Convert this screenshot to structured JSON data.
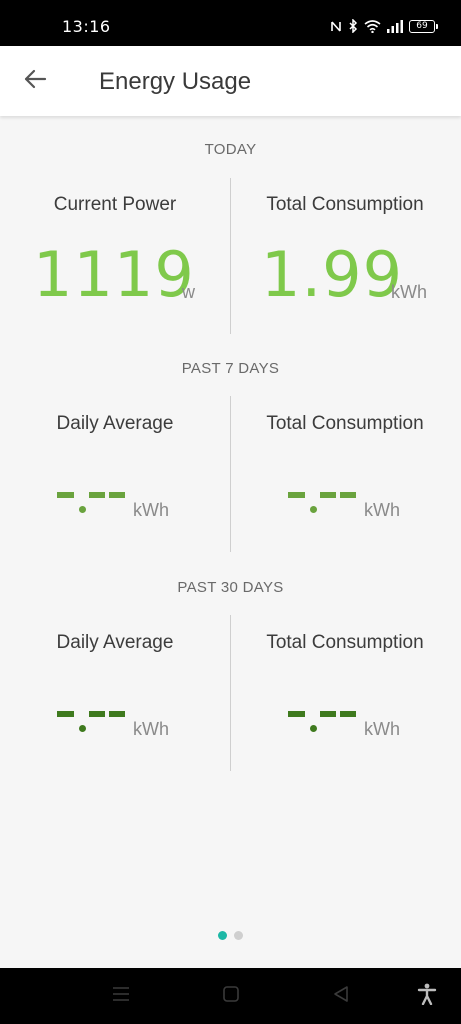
{
  "status_bar": {
    "time": "13:16",
    "battery": "69",
    "icons": [
      "nfc-icon",
      "bluetooth-icon",
      "wifi-icon",
      "signal-icon",
      "battery-icon"
    ]
  },
  "header": {
    "title": "Energy Usage",
    "back_icon": "arrow-left-icon"
  },
  "sections": [
    {
      "title": "TODAY",
      "left": {
        "label": "Current Power",
        "value": "1119",
        "unit": "w"
      },
      "right": {
        "label": "Total Consumption",
        "value": "1.99",
        "unit": "kWh"
      }
    },
    {
      "title": "PAST 7 DAYS",
      "left": {
        "label": "Daily Average",
        "value": "-.--",
        "unit": "kWh"
      },
      "right": {
        "label": "Total Consumption",
        "value": "-.--",
        "unit": "kWh"
      }
    },
    {
      "title": "PAST 30 DAYS",
      "left": {
        "label": "Daily Average",
        "value": "-.--",
        "unit": "kWh"
      },
      "right": {
        "label": "Total Consumption",
        "value": "-.--",
        "unit": "kWh"
      }
    }
  ],
  "pager": {
    "pages": 2,
    "active_index": 0
  },
  "colors": {
    "value_green": "#7fc94b",
    "past7_dash_green": "#6aa33e",
    "past30_dash_green": "#3f7a1e",
    "pager_active": "#1db8a6",
    "pager_inactive": "#cfcfcf"
  },
  "nav_bar": {
    "icons": [
      "menu-icon",
      "home-square-icon",
      "back-triangle-icon",
      "accessibility-icon"
    ]
  }
}
